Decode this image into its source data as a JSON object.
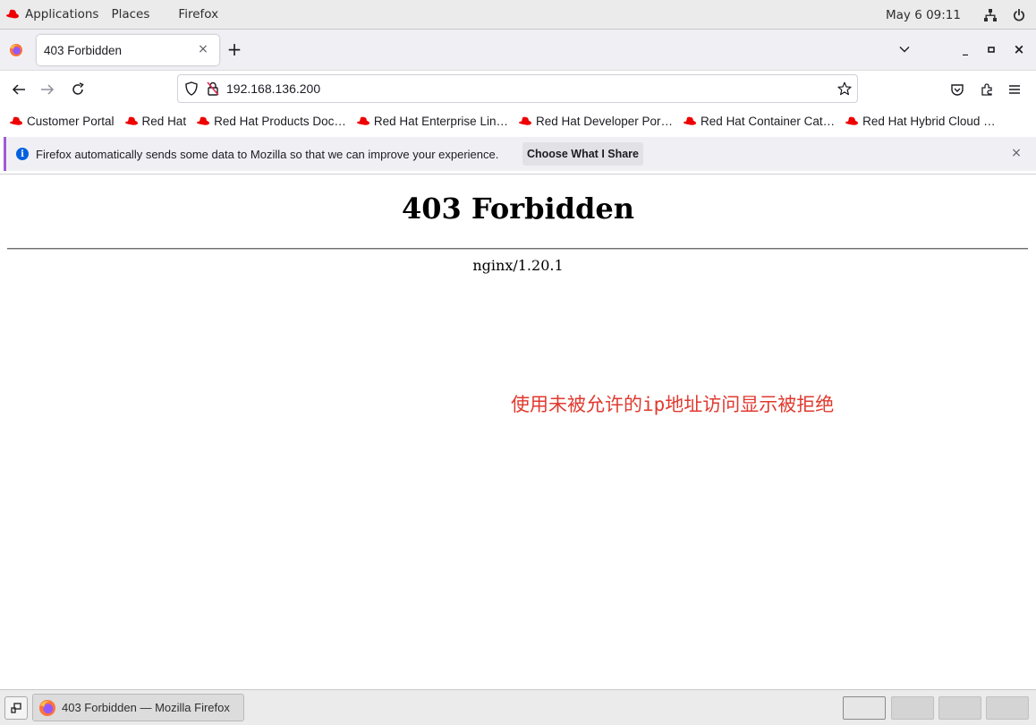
{
  "topbar": {
    "applications": "Applications",
    "places": "Places",
    "app_name": "Firefox",
    "clock": "May 6  09:11",
    "icons": [
      "redhat-icon",
      "network-icon",
      "power-icon"
    ]
  },
  "tabs": {
    "items": [
      {
        "title": "403 Forbidden",
        "active": true
      }
    ],
    "new_tab": "+",
    "close": "×"
  },
  "window_controls": {
    "minimize": "_",
    "maximize": "▫",
    "close": "×"
  },
  "navbar": {
    "url": "192.168.136.200",
    "icons": [
      "back-icon",
      "forward-icon",
      "reload-icon",
      "shield-icon",
      "insecure-lock-icon",
      "bookmark-star-icon",
      "pocket-icon",
      "extensions-icon",
      "menu-icon"
    ]
  },
  "bookmarks": [
    "Customer Portal",
    "Red Hat",
    "Red Hat Products Doc…",
    "Red Hat Enterprise Lin…",
    "Red Hat Developer Por…",
    "Red Hat Container Cat…",
    "Red Hat Hybrid Cloud …"
  ],
  "notification": {
    "message": "Firefox automatically sends some data to Mozilla so that we can improve your experience.",
    "button": "Choose What I Share",
    "close": "×"
  },
  "page": {
    "heading": "403 Forbidden",
    "server": "nginx/1.20.1",
    "annotation": "使用未被允许的ip地址访问显示被拒绝"
  },
  "taskbar": {
    "task_label": "403 Forbidden — Mozilla Firefox",
    "workspaces": 4,
    "active_workspace": 1
  },
  "colors": {
    "redhat": "#ee0000",
    "annotation": "#e03a2f",
    "info": "#0061e0",
    "notif_accent": "#a05cd6"
  }
}
